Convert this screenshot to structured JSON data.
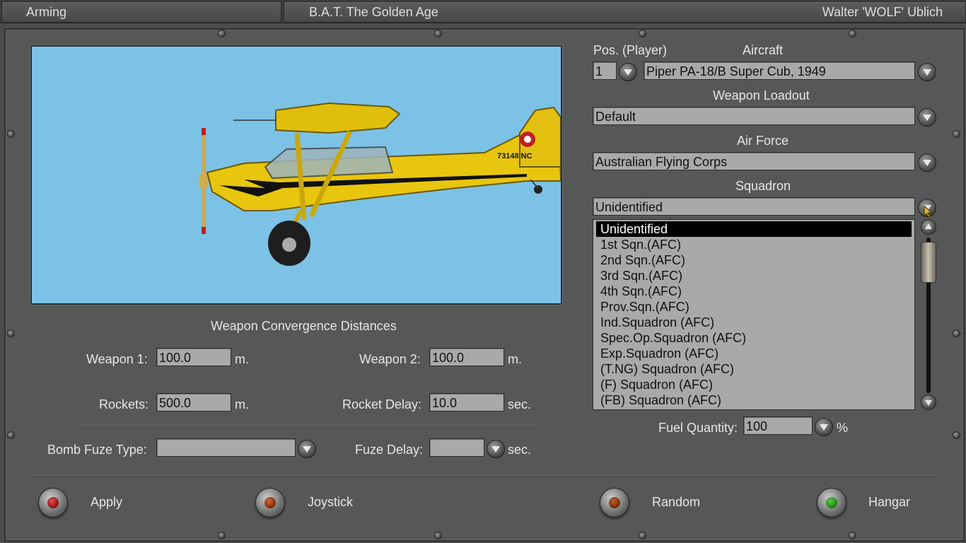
{
  "titlebar": {
    "screen": "Arming",
    "campaign": "B.A.T. The Golden Age",
    "pilot": "Walter 'WOLF' Ublich"
  },
  "aircraft_preview": {
    "tail_number": "73148 NC",
    "colors": {
      "sky": "#7cc2e6",
      "fuselage": "#e8c60e"
    }
  },
  "convergence": {
    "title": "Weapon Convergence Distances",
    "weapon1": {
      "label": "Weapon 1:",
      "value": "100.0",
      "unit": "m."
    },
    "weapon2": {
      "label": "Weapon 2:",
      "value": "100.0",
      "unit": "m."
    },
    "rockets": {
      "label": "Rockets:",
      "value": "500.0",
      "unit": "m."
    },
    "rocket_delay": {
      "label": "Rocket Delay:",
      "value": "10.0",
      "unit": "sec."
    },
    "bomb_fuze_type": {
      "label": "Bomb Fuze Type:",
      "value": ""
    },
    "fuze_delay": {
      "label": "Fuze Delay:",
      "value": "",
      "unit": "sec."
    }
  },
  "setup": {
    "pos_label": "Pos. (Player)",
    "pos_value": "1",
    "aircraft_label": "Aircraft",
    "aircraft_value": "Piper PA-18/B Super Cub, 1949",
    "loadout_label": "Weapon Loadout",
    "loadout_value": "Default",
    "airforce_label": "Air Force",
    "airforce_value": "Australian Flying Corps",
    "squadron_label": "Squadron",
    "squadron_value": "Unidentified",
    "squadron_options": [
      "Unidentified",
      "1st Sqn.(AFC)",
      "2nd Sqn.(AFC)",
      "3rd Sqn.(AFC)",
      "4th Sqn.(AFC)",
      "Prov.Sqn.(AFC)",
      "Ind.Squadron (AFC)",
      "Spec.Op.Squadron (AFC)",
      "Exp.Squadron (AFC)",
      "(T.NG) Squadron (AFC)",
      "(F) Squadron (AFC)",
      "(FB) Squadron (AFC)"
    ],
    "fuel_label": "Fuel Quantity:",
    "fuel_value": "100",
    "fuel_unit": "%"
  },
  "buttons": {
    "apply": "Apply",
    "joystick": "Joystick",
    "random": "Random",
    "hangar": "Hangar"
  },
  "lamp_colors": {
    "apply": "#8a1010",
    "joystick": "#7a2a06",
    "random": "#6a2a06",
    "hangar": "#1f7a12"
  }
}
